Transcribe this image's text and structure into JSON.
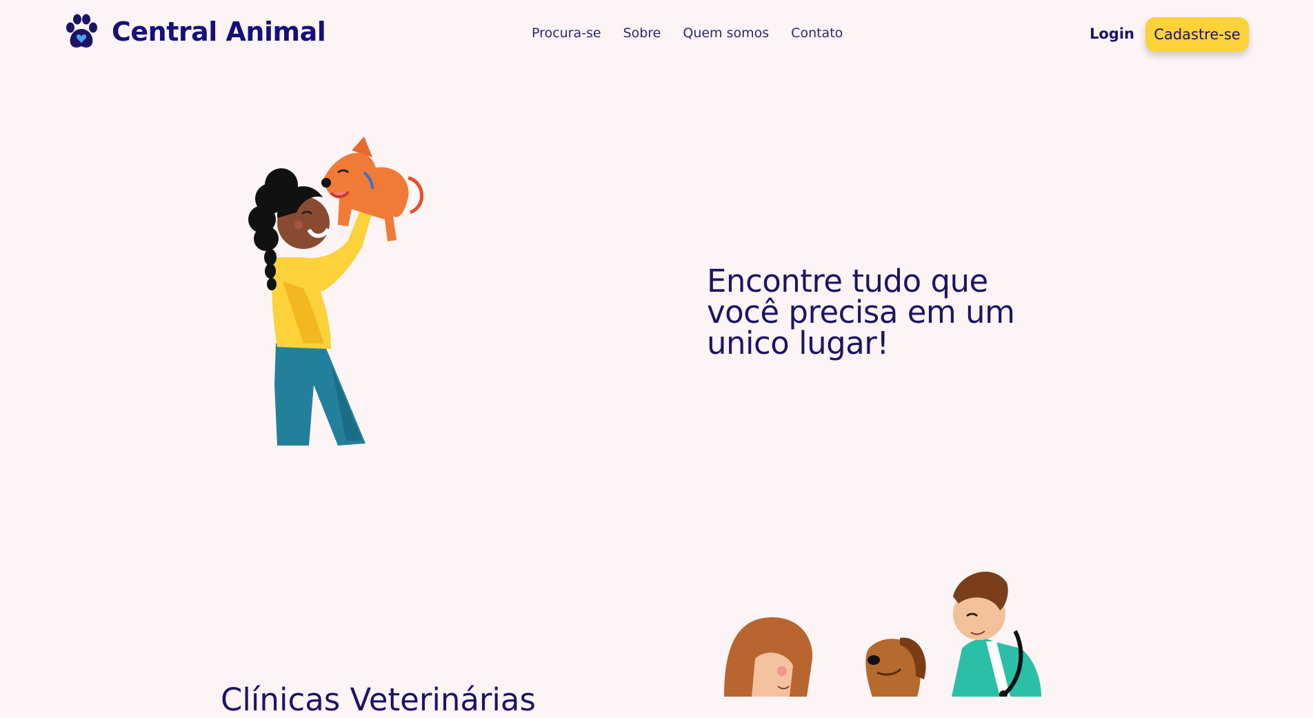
{
  "brand": {
    "name": "Central Animal",
    "logo_icon": "paw-heart-icon"
  },
  "nav": {
    "items": [
      {
        "label": "Procura-se"
      },
      {
        "label": "Sobre"
      },
      {
        "label": "Quem somos"
      },
      {
        "label": "Contato"
      }
    ]
  },
  "auth": {
    "login_label": "Login",
    "signup_label": "Cadastre-se"
  },
  "hero": {
    "title": "Encontre tudo que você precisa em um unico lugar!",
    "illustration": "woman-lifting-dog-illustration"
  },
  "section2": {
    "title": "Clínicas Veterinárias",
    "illustration": "vet-with-dog-illustration"
  },
  "colors": {
    "background": "#fcf4f5",
    "primary": "#1b1464",
    "accent": "#fdd23a"
  }
}
